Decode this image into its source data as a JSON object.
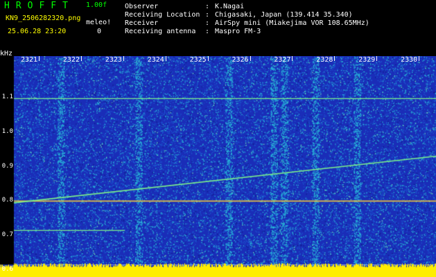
{
  "header": {
    "app_title": "HROFFT",
    "version": "1.00f",
    "filename": "KN9_2506282320.png",
    "meteor_label": "meleo!",
    "meteor_count": "0",
    "datetime": "25.06.28 23:20",
    "fields": [
      {
        "label": "Observer",
        "sep": ":",
        "value": "K.Nagai"
      },
      {
        "label": "Receiving Location",
        "sep": ":",
        "value": "Chigasaki, Japan (139.414 35.340)"
      },
      {
        "label": "Receiver",
        "sep": ":",
        "value": "AirSpy mini (Miakejima VOR 108.65MHz)"
      },
      {
        "label": "Receiving antenna",
        "sep": ":",
        "value": "Maspro FM-3"
      }
    ]
  },
  "plot": {
    "y_unit": "kHz",
    "y_range": [
      0.58,
      1.22
    ],
    "y_ticks": [
      "1.1",
      "1.0",
      "0.9",
      "0.8",
      "0.7",
      "0.6"
    ],
    "y_tick_values": [
      1.1,
      1.0,
      0.9,
      0.8,
      0.7,
      0.6
    ],
    "x_labels": [
      "2321",
      "2322",
      "2323",
      "2324",
      "2325",
      "2326",
      "2327",
      "2328",
      "2329",
      "2330"
    ],
    "colors": {
      "background": "#1a2db8",
      "noise": "#28b4d8",
      "trace": "#7cf08a",
      "floor": "#ffee00"
    }
  }
}
